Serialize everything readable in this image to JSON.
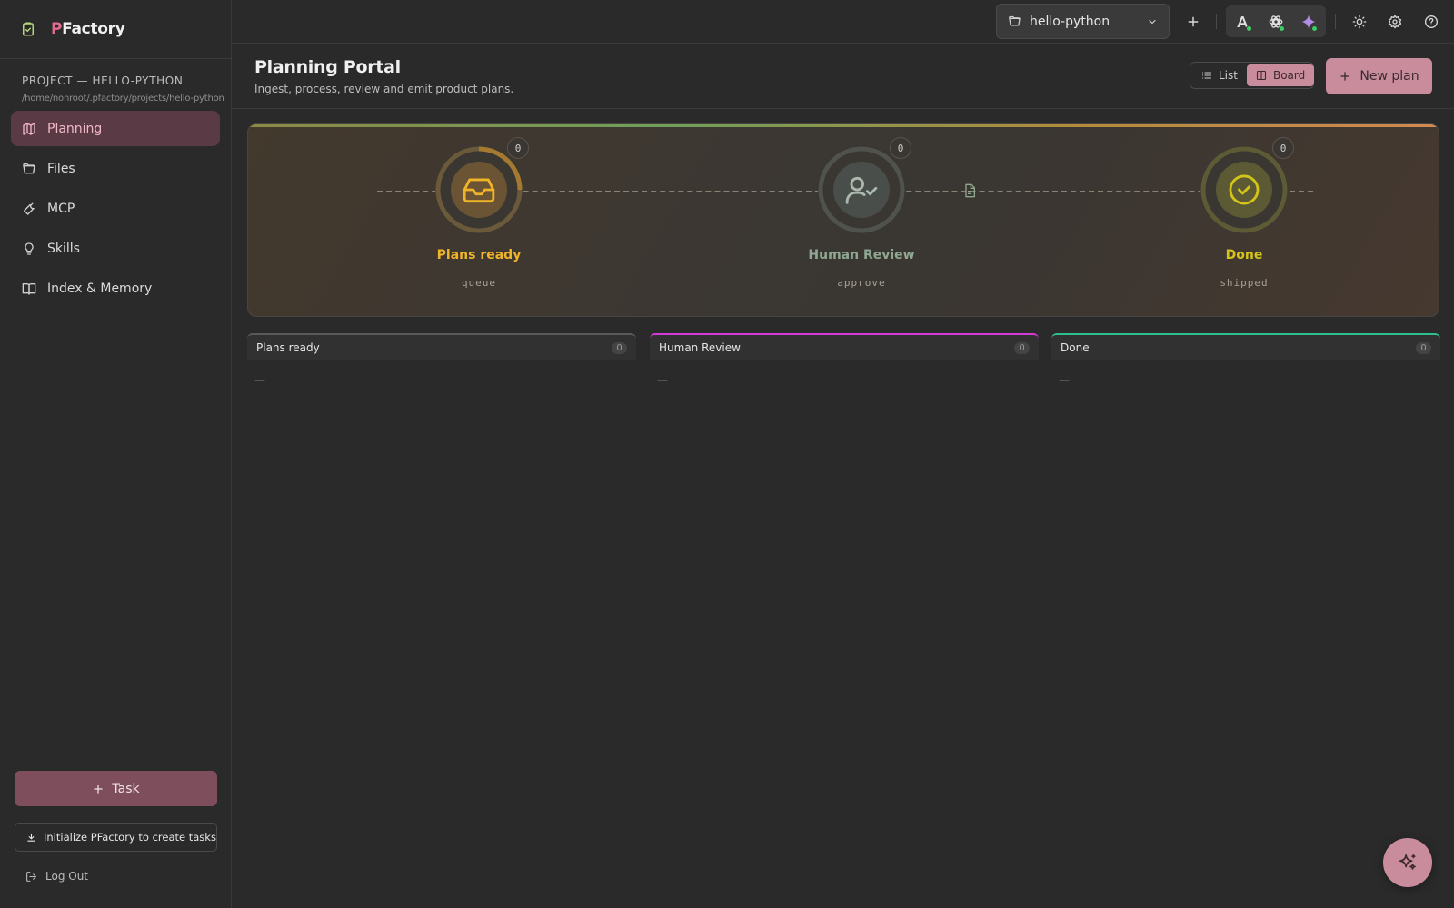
{
  "app": {
    "brand_first": "P",
    "brand_rest": "Factory",
    "accent": "#c98c9c"
  },
  "sidebar": {
    "project_title": "PROJECT — HELLO-PYTHON",
    "project_path": "/home/nonroot/.pfactory/projects/hello-python",
    "items": [
      {
        "label": "Planning",
        "icon": "map-icon",
        "active": true
      },
      {
        "label": "Files",
        "icon": "folder-open-icon",
        "active": false
      },
      {
        "label": "MCP",
        "icon": "wrench-icon",
        "active": false
      },
      {
        "label": "Skills",
        "icon": "lightbulb-icon",
        "active": false
      },
      {
        "label": "Index & Memory",
        "icon": "book-open-icon",
        "active": false
      }
    ],
    "task_label": "Task",
    "init_label": "Initialize PFactory to create tasks",
    "logout_label": "Log Out"
  },
  "topbar": {
    "project_select_value": "hello-python"
  },
  "header": {
    "title": "Planning Portal",
    "subtitle": "Ingest, process, review and emit product plans.",
    "view_list": "List",
    "view_board": "Board",
    "active_view": "Board",
    "new_plan_label": "New plan"
  },
  "pipeline": {
    "stages": [
      {
        "label": "Plans ready",
        "sub": "queue",
        "count": "0",
        "color": "#f0b429"
      },
      {
        "label": "Human Review",
        "sub": "approve",
        "count": "0",
        "color": "#8fa793"
      },
      {
        "label": "Done",
        "sub": "shipped",
        "count": "0",
        "color": "#d4c41a"
      }
    ]
  },
  "board": {
    "columns": [
      {
        "title": "Plans ready",
        "count": "0",
        "empty": "—",
        "accent": "#5a5a5a"
      },
      {
        "title": "Human Review",
        "count": "0",
        "empty": "—",
        "accent": "#d33ad8"
      },
      {
        "title": "Done",
        "count": "0",
        "empty": "—",
        "accent": "#2fbf8f"
      }
    ]
  }
}
